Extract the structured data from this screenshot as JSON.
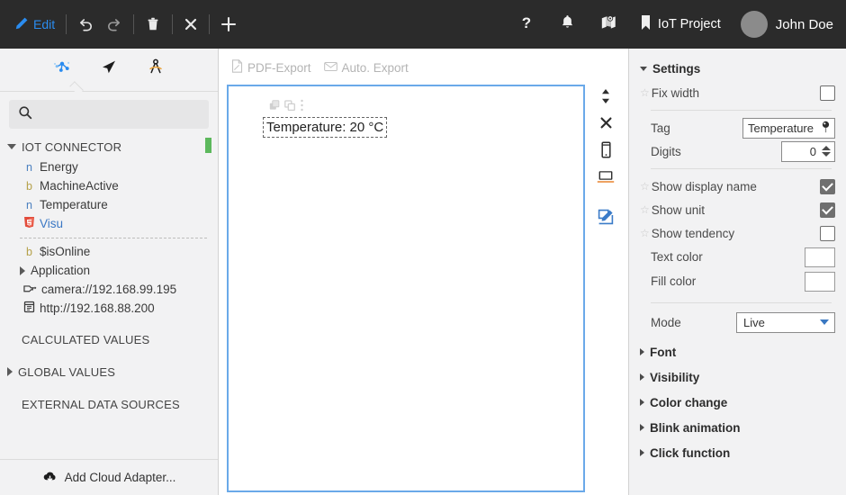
{
  "topbar": {
    "edit_label": "Edit",
    "undo_icon": "undo-icon",
    "redo_icon": "redo-icon",
    "delete_icon": "trash-icon",
    "close_icon": "close-icon",
    "add_icon": "plus-icon",
    "help_icon": "help-question-icon",
    "notifications_icon": "bell-icon",
    "map_icon": "map-pin-icon",
    "bookmark_icon": "bookmark-icon",
    "project_label": "IoT Project",
    "user_label": "John Doe",
    "accent_color": "#2a8cf0",
    "background_color": "#2b2b2b"
  },
  "sidebar": {
    "tabs": [
      {
        "name": "connector-tab",
        "icon": "network-nodes-icon",
        "active": true
      },
      {
        "name": "navigate-tab",
        "icon": "cursor-arrow-icon",
        "active": false
      },
      {
        "name": "design-tab",
        "icon": "compass-divider-icon",
        "active": false
      }
    ],
    "search": {
      "value": "",
      "placeholder": "",
      "icon": "search-icon"
    },
    "tree": [
      {
        "label": "IOT CONNECTOR",
        "kind": "group",
        "expanded": true,
        "status": "ok",
        "status_color": "#5cb85c"
      },
      {
        "label": "Energy",
        "kind": "tag",
        "type": "n"
      },
      {
        "label": "MachineActive",
        "kind": "tag",
        "type": "b"
      },
      {
        "label": "Temperature",
        "kind": "tag",
        "type": "n"
      },
      {
        "label": "Visu",
        "kind": "visu",
        "icon": "html5-icon"
      },
      {
        "label": "$isOnline",
        "kind": "tag",
        "type": "b"
      },
      {
        "label": "Application",
        "kind": "folder",
        "expanded": false
      },
      {
        "label": "camera://192.168.99.195",
        "kind": "link",
        "icon": "camera-icon"
      },
      {
        "label": "http://192.168.88.200",
        "kind": "link",
        "icon": "browser-icon"
      },
      {
        "label": "CALCULATED VALUES",
        "kind": "group",
        "expanded": null
      },
      {
        "label": "GLOBAL VALUES",
        "kind": "group",
        "expanded": false
      },
      {
        "label": "EXTERNAL DATA SOURCES",
        "kind": "group",
        "expanded": null
      }
    ],
    "add_adapter_label": "Add Cloud Adapter...",
    "add_adapter_icon": "cloud-download-icon"
  },
  "main": {
    "pdf_export_label": "PDF-Export",
    "pdf_export_icon": "pdf-document-icon",
    "auto_export_label": "Auto. Export",
    "auto_export_icon": "envelope-icon",
    "canvas_border_color": "#6aa9e9",
    "widget": {
      "text": "Temperature: 20 °C",
      "selected": true
    },
    "tools": [
      {
        "name": "resize-vertical-tool",
        "icon": "up-down-arrow-icon"
      },
      {
        "name": "close-tool",
        "icon": "close-icon"
      },
      {
        "name": "mobile-preview-tool",
        "icon": "smartphone-icon"
      },
      {
        "name": "desktop-preview-tool",
        "icon": "laptop-icon"
      },
      {
        "name": "edit-tool",
        "icon": "edit-pencil-box-icon"
      }
    ]
  },
  "settings": {
    "title": "Settings",
    "fix_width": {
      "label": "Fix width",
      "checked": false
    },
    "tag": {
      "label": "Tag",
      "value": "Temperature",
      "icon": "pin-icon"
    },
    "digits": {
      "label": "Digits",
      "value": "0"
    },
    "show_display_name": {
      "label": "Show display name",
      "checked": true
    },
    "show_unit": {
      "label": "Show unit",
      "checked": true
    },
    "show_tendency": {
      "label": "Show tendency",
      "checked": false
    },
    "text_color": {
      "label": "Text color",
      "value": "#ffffff"
    },
    "fill_color": {
      "label": "Fill color",
      "value": "#ffffff"
    },
    "mode": {
      "label": "Mode",
      "value": "Live"
    },
    "sections": [
      {
        "label": "Font",
        "expanded": false
      },
      {
        "label": "Visibility",
        "expanded": false
      },
      {
        "label": "Color change",
        "expanded": false
      },
      {
        "label": "Blink animation",
        "expanded": false
      },
      {
        "label": "Click function",
        "expanded": false
      }
    ]
  }
}
